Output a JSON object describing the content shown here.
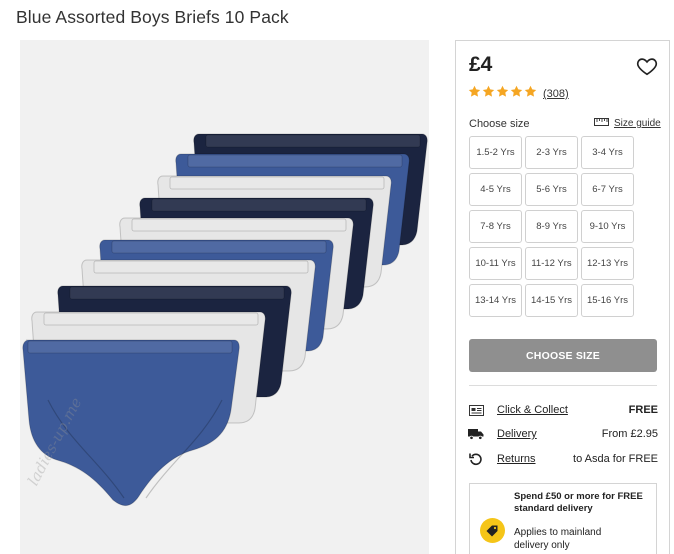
{
  "product": {
    "title": "Blue Assorted Boys Briefs 10 Pack",
    "price": "£4",
    "rating_count": "(308)",
    "rating_stars": 5
  },
  "image": {
    "watermark": "ladies-up.me"
  },
  "size_selector": {
    "label": "Choose size",
    "guide_label": "Size guide",
    "sizes": [
      "1.5-2 Yrs",
      "2-3 Yrs",
      "3-4 Yrs",
      "4-5 Yrs",
      "5-6 Yrs",
      "6-7 Yrs",
      "7-8 Yrs",
      "8-9 Yrs",
      "9-10 Yrs",
      "10-11 Yrs",
      "11-12 Yrs",
      "12-13 Yrs",
      "13-14 Yrs",
      "14-15 Yrs",
      "15-16 Yrs"
    ],
    "button_label": "CHOOSE SIZE"
  },
  "delivery": {
    "click_collect": {
      "label": "Click & Collect",
      "value": "FREE"
    },
    "delivery": {
      "label": "Delivery",
      "value": "From £2.95"
    },
    "returns": {
      "label": "Returns",
      "value": "to Asda for FREE"
    }
  },
  "promo": {
    "headline": "Spend £50 or more for FREE standard delivery",
    "note": "Applies to mainland delivery only"
  },
  "colors": {
    "star": "#f5a623",
    "button_disabled": "#8f8f8f",
    "promo_badge": "#f5c518",
    "navy": "#1b2440",
    "royal": "#3d5a99",
    "white_brief": "#e6e6e6"
  },
  "icons": [
    "heart-icon",
    "star-icon",
    "ruler-icon",
    "store-icon",
    "truck-icon",
    "return-icon",
    "tag-icon"
  ]
}
